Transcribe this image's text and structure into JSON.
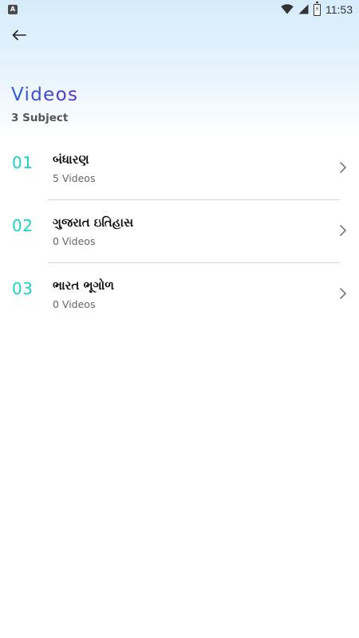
{
  "status_bar": {
    "notification_icon_letter": "A",
    "battery_glyph": "⚡",
    "time": "11:53",
    "icons": [
      "notification-icon",
      "wifi-icon",
      "signal-icon",
      "battery-icon"
    ]
  },
  "header": {
    "title": "Videos",
    "subtitle": "3 Subject",
    "back_icon": "arrow-left-icon",
    "title_gradient": [
      "#2d63d6",
      "#5a30c8"
    ]
  },
  "colors": {
    "accent_number": "#19d3c5",
    "header_bg": "#d6ecfb"
  },
  "items": [
    {
      "number": "01",
      "title": "બંધારણ",
      "count": "5 Videos"
    },
    {
      "number": "02",
      "title": "ગુજરાત ઇતિહાસ",
      "count": "0 Videos"
    },
    {
      "number": "03",
      "title": "ભારત ભૂગોળ",
      "count": "0 Videos"
    }
  ]
}
